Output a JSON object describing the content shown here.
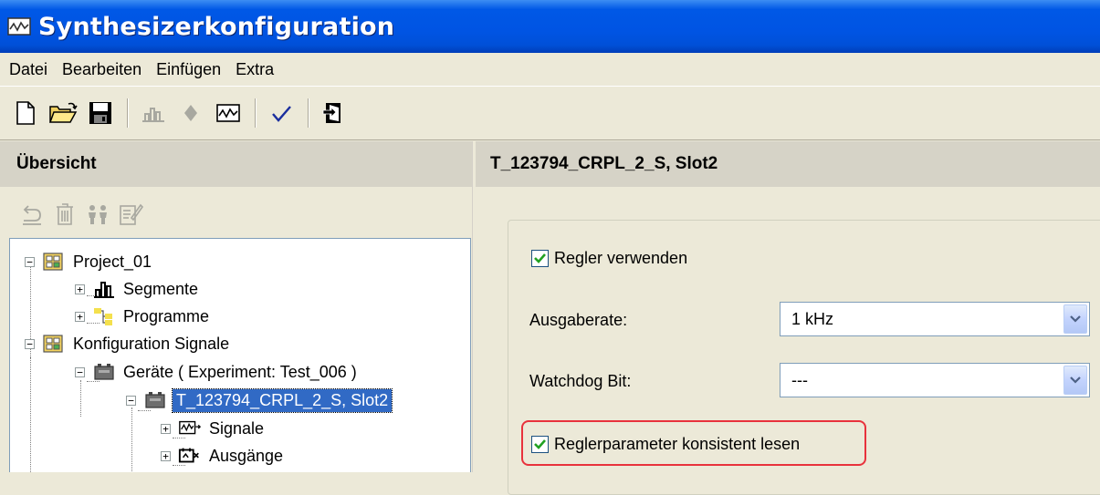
{
  "window": {
    "title": "Synthesizerkonfiguration"
  },
  "menu": [
    "Datei",
    "Bearbeiten",
    "Einfügen",
    "Extra"
  ],
  "toolbar": {
    "icons": [
      "new-icon",
      "open-icon",
      "save-icon",
      "segment-icon",
      "diamond-icon",
      "signal-icon",
      "check-icon",
      "exit-icon"
    ]
  },
  "left_pane": {
    "header": "Übersicht",
    "toolbar_icons": [
      "undo-icon",
      "delete-icon",
      "users-icon",
      "properties-icon"
    ],
    "tree": [
      {
        "label": "Project_01",
        "level": 0,
        "expander": "−"
      },
      {
        "label": "Segmente",
        "level": 1,
        "expander": "+"
      },
      {
        "label": "Programme",
        "level": 1,
        "expander": "+"
      },
      {
        "label": "Konfiguration Signale",
        "level": 0,
        "expander": "−"
      },
      {
        "label": "Geräte ( Experiment: Test_006 )",
        "level": 1,
        "expander": "−"
      },
      {
        "label": "T_123794_CRPL_2_S, Slot2",
        "level": 2,
        "expander": "−",
        "selected": true
      },
      {
        "label": "Signale",
        "level": 3,
        "expander": "+"
      },
      {
        "label": "Ausgänge",
        "level": 3,
        "expander": "+"
      }
    ]
  },
  "right_pane": {
    "header": "T_123794_CRPL_2_S, Slot2",
    "regler_verwenden": {
      "label": "Regler verwenden",
      "checked": true
    },
    "ausgaberate": {
      "label": "Ausgaberate:",
      "value": "1 kHz"
    },
    "watchdog": {
      "label": "Watchdog Bit:",
      "value": "---"
    },
    "konsistent": {
      "label": "Reglerparameter konsistent lesen",
      "checked": true
    }
  },
  "colors": {
    "titlebar": "#0054e3",
    "selection": "#316ac5",
    "highlight": "#e8323c",
    "check": "#21a121"
  }
}
